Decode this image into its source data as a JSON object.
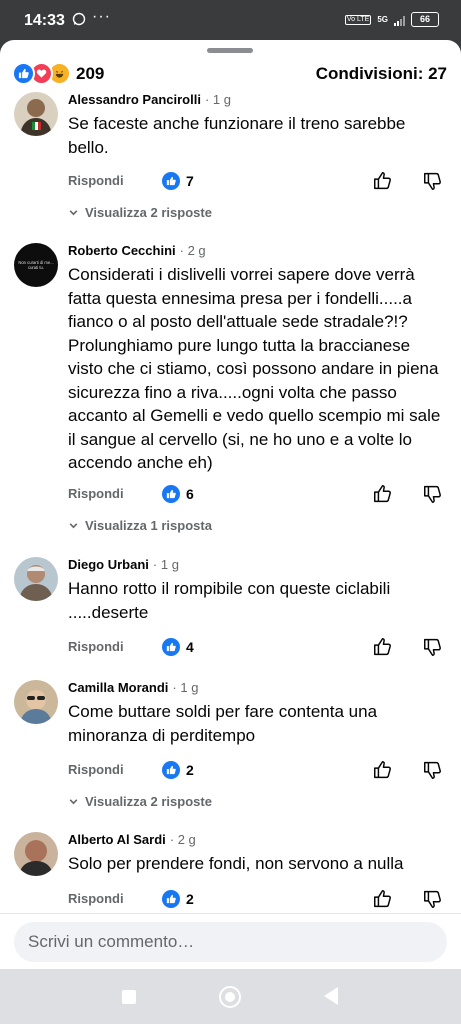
{
  "status_bar": {
    "time": "14:33",
    "network": "5G",
    "volte": "Vo LTE",
    "battery": "66"
  },
  "post": {
    "reaction_count": "209",
    "shares_label": "Condivisioni: 27"
  },
  "comments": [
    {
      "name": "Alessandro Pancirolli",
      "time": "· 1 g",
      "text": "Se faceste anche funzionare il treno sarebbe bello.",
      "reply_label": "Rispondi",
      "like_count": "7",
      "view_replies": "Visualizza 2 risposte",
      "avatar_color": "#7a5a3a"
    },
    {
      "name": "Roberto Cecchini",
      "time": "· 2 g",
      "text": "Considerati i dislivelli vorrei sapere dove verrà fatta questa ennesima presa per i fondelli.....a fianco o al posto dell'attuale sede stradale?!? Prolunghiamo pure lungo tutta la braccianese visto che ci stiamo, così possono andare in piena sicurezza fino a riva.....ogni volta che passo accanto al Gemelli e vedo quello scempio mi sale il sangue al cervello (si, ne ho uno e a volte lo accendo anche eh)",
      "reply_label": "Rispondi",
      "like_count": "6",
      "view_replies": "Visualizza 1 risposta",
      "avatar_color": "#0d0d0d",
      "avatar_text": "Non curarti di me... curati tu."
    },
    {
      "name": "Diego Urbani",
      "time": "· 1 g",
      "text": "Hanno rotto il rompibile con queste ciclabili .....deserte",
      "reply_label": "Rispondi",
      "like_count": "4",
      "avatar_color": "#8c7e6e"
    },
    {
      "name": "Camilla Morandi",
      "time": "· 1 g",
      "text": "Come buttare soldi per fare contenta una minoranza di perditempo",
      "reply_label": "Rispondi",
      "like_count": "2",
      "view_replies": "Visualizza 2 risposte",
      "avatar_color": "#b9a58a"
    },
    {
      "name": "Alberto Al Sardi",
      "time": "· 2 g",
      "text": "Solo per prendere fondi, non servono a nulla",
      "reply_label": "Rispondi",
      "like_count": "2",
      "avatar_color": "#9a6b52"
    }
  ],
  "composer": {
    "placeholder": "Scrivi un commento…"
  },
  "colors": {
    "facebook_blue": "#1877f2",
    "love_red": "#f33e58",
    "haha_yellow": "#f7b125",
    "secondary_text": "#65676b"
  }
}
